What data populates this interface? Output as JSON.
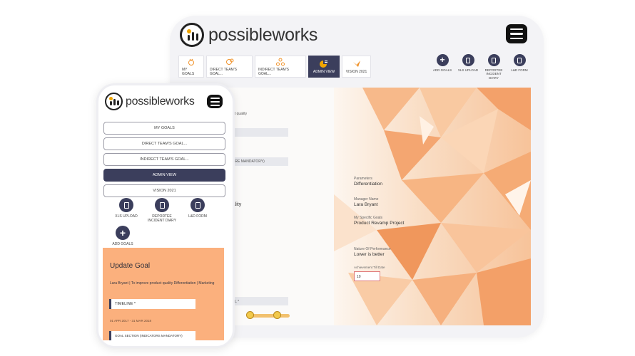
{
  "brand": {
    "name": "possibleworks"
  },
  "tablet": {
    "tabs": [
      {
        "label": "MY GOALS",
        "icon": "trophy-icon"
      },
      {
        "label": "DIRECT TEAM'S GOAL...",
        "icon": "team-icon"
      },
      {
        "label": "INDIRECT TEAM'S GOAL...",
        "icon": "hierarchy-icon"
      },
      {
        "label": "ADMIN VIEW",
        "icon": "chart-icon",
        "active": true
      },
      {
        "label": "VISION 2021",
        "icon": "bird-icon"
      }
    ],
    "actions": [
      {
        "label": "ADD GOALS",
        "icon": "plus-icon"
      },
      {
        "label": "XLS UPLOAD",
        "icon": "document-icon"
      },
      {
        "label": "REPORTEE INCIDENT DIARY",
        "icon": "document-icon"
      },
      {
        "label": "L&D FORM",
        "icon": "document-icon"
      }
    ],
    "left_fragments": {
      "text1": "oduct quality",
      "text2": "RS ARE MANDATORY)",
      "text3": "quality",
      "text4": "GOAL *"
    },
    "fields": [
      {
        "label": "Parameters",
        "value": "Differentiation"
      },
      {
        "label": "Manager Name",
        "value": "Lara Bryant"
      },
      {
        "label": "My Specific Goals",
        "value": "Product Revamp Project"
      },
      {
        "label": "Nature Of Performance",
        "value": "Lower is better"
      }
    ],
    "achievement": {
      "label": "Achievement Till Date",
      "value": "10"
    }
  },
  "phone": {
    "nav": [
      {
        "label": "MY GOALS"
      },
      {
        "label": "DIRECT TEAM'S GOAL..."
      },
      {
        "label": "INDIRECT TEAM'S GOAL..."
      },
      {
        "label": "ADMIN VIEW",
        "active": true
      },
      {
        "label": "VISION 2021"
      }
    ],
    "actions": [
      {
        "label": "XLS UPLOAD"
      },
      {
        "label": "REPORTEE INCIDENT DIARY"
      },
      {
        "label": "L&D FORM"
      }
    ],
    "add_goals": "ADD GOALS",
    "panel": {
      "title": "Update Goal",
      "subtitle": "Lara Bryant | To improve product quality Differentiation | Marketing",
      "timeline": "TIMELINE *",
      "dates": "01 APR 2017 - 31 MAR 2018",
      "goal_section": "GOAL SECTION (INDICATORS MANDATORY)"
    }
  },
  "colors": {
    "navy": "#3b3e5c",
    "orange": "#fbb07d",
    "accent": "#f0a500"
  }
}
